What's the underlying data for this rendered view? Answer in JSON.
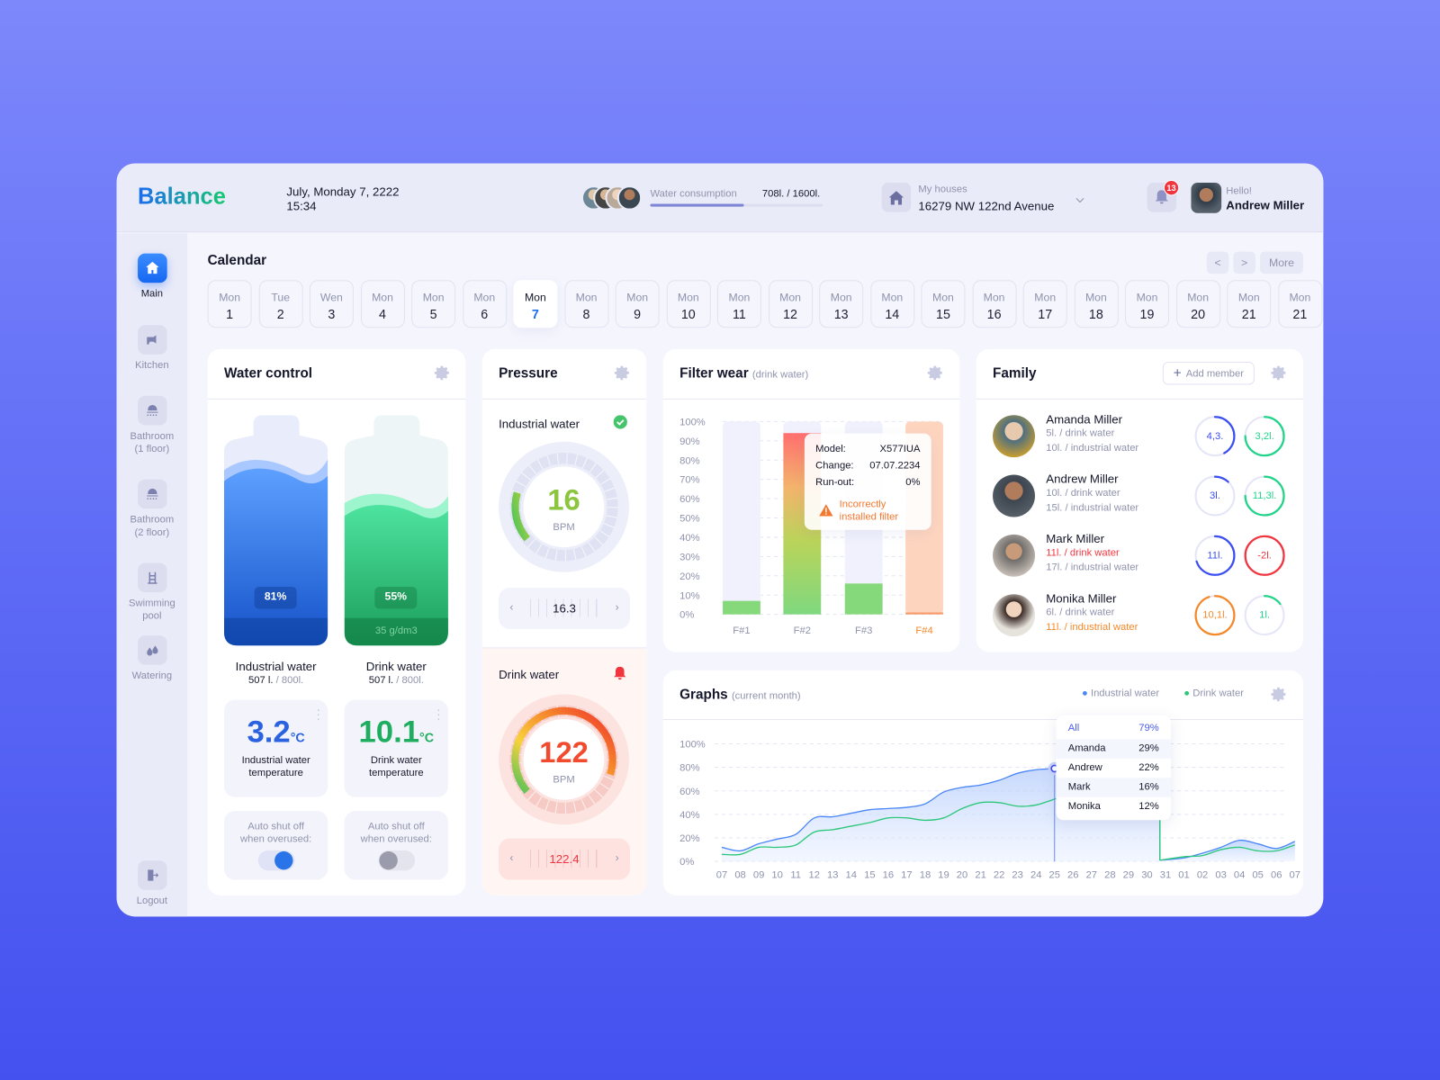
{
  "header": {
    "logo": "Balance",
    "date": "July, Monday 7, 2222",
    "time": "15:34",
    "consumption_label": "Water consumption",
    "consumption_value": "708l. / 1600l.",
    "consumption_fill": 0.54,
    "houses_label": "My houses",
    "house_address": "16279 NW 122nd Avenue",
    "notifications_count": "13",
    "greeting": "Hello!",
    "user_name": "Andrew Miller"
  },
  "sidebar": {
    "items": [
      {
        "label": "Main",
        "icon": "home-icon",
        "active": true
      },
      {
        "label": "Kitchen",
        "icon": "faucet-icon"
      },
      {
        "label": "Bathroom\n(1 floor)",
        "icon": "shower-icon"
      },
      {
        "label": "Bathroom\n(2 floor)",
        "icon": "shower-icon"
      },
      {
        "label": "Swimming\npool",
        "icon": "pool-ladder-icon"
      },
      {
        "label": "Watering",
        "icon": "water-drops-icon"
      }
    ],
    "logout": "Logout"
  },
  "calendar": {
    "title": "Calendar",
    "more": "More",
    "prev": "<",
    "next": ">",
    "selected_index": 6,
    "days": [
      {
        "name": "Mon",
        "num": "1"
      },
      {
        "name": "Tue",
        "num": "2"
      },
      {
        "name": "Wen",
        "num": "3"
      },
      {
        "name": "Mon",
        "num": "4"
      },
      {
        "name": "Mon",
        "num": "5"
      },
      {
        "name": "Mon",
        "num": "6"
      },
      {
        "name": "Mon",
        "num": "7"
      },
      {
        "name": "Mon",
        "num": "8"
      },
      {
        "name": "Mon",
        "num": "9"
      },
      {
        "name": "Mon",
        "num": "10"
      },
      {
        "name": "Mon",
        "num": "11"
      },
      {
        "name": "Mon",
        "num": "12"
      },
      {
        "name": "Mon",
        "num": "13"
      },
      {
        "name": "Mon",
        "num": "14"
      },
      {
        "name": "Mon",
        "num": "15"
      },
      {
        "name": "Mon",
        "num": "16"
      },
      {
        "name": "Mon",
        "num": "17"
      },
      {
        "name": "Mon",
        "num": "18"
      },
      {
        "name": "Mon",
        "num": "19"
      },
      {
        "name": "Mon",
        "num": "20"
      },
      {
        "name": "Mon",
        "num": "21"
      },
      {
        "name": "Mon",
        "num": "21"
      }
    ]
  },
  "water_control": {
    "title": "Water control",
    "industrial": {
      "percent": "81%",
      "level": 0.81,
      "label": "Industrial water",
      "amount": "507 l.",
      "capacity": "/ 800l.",
      "temp": "3.2",
      "temp_unit": "°C",
      "temp_label": "Industrial water temperature",
      "auto_label": "Auto shut off when overused:",
      "auto_on": true
    },
    "drink": {
      "percent": "55%",
      "level": 0.55,
      "hardness": "35 g/dm3",
      "label": "Drink water",
      "amount": "507 l.",
      "capacity": "/ 800l.",
      "temp": "10.1",
      "temp_unit": "°C",
      "temp_label": "Drink water temperature",
      "auto_label": "Auto shut off when overused:",
      "auto_on": false
    }
  },
  "pressure": {
    "title": "Pressure",
    "industrial": {
      "label": "Industrial water",
      "value": "16",
      "unit": "BPM",
      "setting": "16.3",
      "status": "ok"
    },
    "drink": {
      "label": "Drink water",
      "value": "122",
      "unit": "BPM",
      "setting": "122.4",
      "status": "alert"
    }
  },
  "filter_wear": {
    "title": "Filter wear",
    "subtitle": "(drink water)",
    "tooltip": {
      "model_label": "Model:",
      "model": "X577IUA",
      "change_label": "Change:",
      "change": "07.07.2234",
      "runout_label": "Run-out:",
      "runout": "0%",
      "warning": "Incorrectly installed filter"
    }
  },
  "family": {
    "title": "Family",
    "add_member": "Add member",
    "members": [
      {
        "name": "Amanda Miller",
        "drink": "5l. / drink water",
        "industrial": "10l. / industrial water",
        "ring1": "4,3.",
        "ring1_fill": 0.42,
        "ring1_color": "#3b4ef0",
        "ring2": "3,2l.",
        "ring2_fill": 0.75,
        "ring2_color": "#22d38a",
        "alert": ""
      },
      {
        "name": "Andrew Miller",
        "drink": "10l. / drink water",
        "industrial": "15l. / industrial water",
        "ring1": "3l.",
        "ring1_fill": 0.12,
        "ring1_color": "#3b4ef0",
        "ring2": "11,3l.",
        "ring2_fill": 0.75,
        "ring2_color": "#22d38a",
        "alert": ""
      },
      {
        "name": "Mark Miller",
        "drink": "11l. / drink water",
        "industrial": "17l. / industrial water",
        "ring1": "11l.",
        "ring1_fill": 0.7,
        "ring1_color": "#3b4ef0",
        "ring2": "-2l.",
        "ring2_fill": 1.0,
        "ring2_color": "#f0353f",
        "alert": "drink"
      },
      {
        "name": "Monika Miller",
        "drink": "6l. / drink water",
        "industrial": "11l. / industrial water",
        "ring1": "10,1l.",
        "ring1_fill": 0.95,
        "ring1_color": "#f4892a",
        "ring2": "1l.",
        "ring2_fill": 0.15,
        "ring2_color": "#22d38a",
        "alert": "industrial"
      }
    ]
  },
  "graphs": {
    "title": "Graphs",
    "subtitle": "(current month)",
    "tooltip": {
      "rows": [
        {
          "name": "All",
          "value": "79%"
        },
        {
          "name": "Amanda",
          "value": "29%"
        },
        {
          "name": "Andrew",
          "value": "22%"
        },
        {
          "name": "Mark",
          "value": "16%"
        },
        {
          "name": "Monika",
          "value": "12%"
        }
      ]
    }
  },
  "chart_data": [
    {
      "type": "bar",
      "title": "Filter wear",
      "categories": [
        "F#1",
        "F#2",
        "F#3",
        "F#4"
      ],
      "values": [
        7,
        94,
        16,
        1
      ],
      "highlighted": "F#4",
      "yticks": [
        "0%",
        "10%",
        "20%",
        "30%",
        "40%",
        "50%",
        "60%",
        "70%",
        "80%",
        "90%",
        "100%"
      ],
      "ylim": [
        0,
        100
      ],
      "grid": true
    },
    {
      "type": "area",
      "title": "Graphs",
      "x": [
        "07",
        "08",
        "09",
        "10",
        "11",
        "12",
        "13",
        "14",
        "15",
        "16",
        "17",
        "18",
        "19",
        "20",
        "21",
        "22",
        "23",
        "24",
        "25",
        "26",
        "27",
        "28",
        "29",
        "30",
        "31",
        "01",
        "02",
        "03",
        "04",
        "05",
        "06",
        "07"
      ],
      "series": [
        {
          "name": "Industrial water",
          "color": "#4a86f7",
          "values": [
            12,
            9,
            15,
            19,
            23,
            37,
            38,
            41,
            44,
            45,
            46,
            49,
            59,
            63,
            65,
            69,
            75,
            78,
            79,
            80,
            81,
            82,
            83,
            84,
            1,
            3,
            7,
            12,
            18,
            15,
            11,
            17
          ]
        },
        {
          "name": "Drink water",
          "color": "#2cc77a",
          "values": [
            6,
            6,
            12,
            12,
            14,
            25,
            27,
            30,
            33,
            37,
            37,
            35,
            37,
            45,
            50,
            50,
            47,
            48,
            53,
            58,
            60,
            62,
            63,
            64,
            1,
            4,
            5,
            10,
            12,
            9,
            9,
            14
          ]
        }
      ],
      "yticks": [
        "0%",
        "20%",
        "40%",
        "60%",
        "80%",
        "100%"
      ],
      "ylim": [
        0,
        100
      ],
      "grid": true,
      "legend": "top-right",
      "highlight_x": "25"
    }
  ]
}
